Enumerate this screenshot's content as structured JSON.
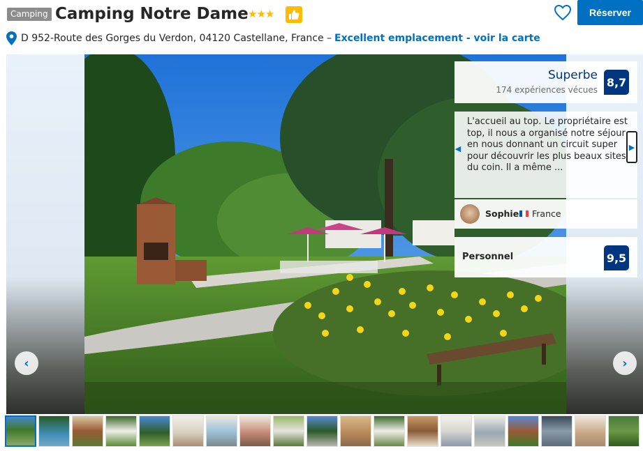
{
  "header": {
    "type_badge": "Camping",
    "title": "Camping Notre Dame",
    "stars": "★★★",
    "stars_count": 3,
    "reserve_label": "Réserver",
    "address": "D 952-Route des Gorges du Verdon, 04120 Castellane, France –",
    "map_link": "Excellent emplacement - voir la carte"
  },
  "icons": {
    "thumbs_up": "thumbs-up-icon",
    "heart": "heart-icon",
    "pin": "map-pin-icon",
    "prev": "chevron-left-icon",
    "next": "chevron-right-icon"
  },
  "gallery": {
    "prev_symbol": "‹",
    "next_symbol": "›",
    "thumbnail_count": 19,
    "active_thumbnail": 1
  },
  "review_panel": {
    "score_word": "Superbe",
    "review_count": "174 expériences vécues",
    "score": "8,7",
    "quote": "L'accueil au top. Le propriétaire est top, il nous a organisé notre séjour en nous donnant un circuit super pour découvrir les plus beaux sites du coin. Il a même ...",
    "quote_prev": "◀",
    "quote_next": "▶",
    "author_name": "Sophie",
    "author_country": "France",
    "category_label": "Personnel",
    "category_score": "9,5"
  },
  "colors": {
    "brand_blue": "#0071c2",
    "dark_blue": "#003580",
    "star_yellow": "#febb02",
    "badge_gray": "#8c8c8c"
  }
}
